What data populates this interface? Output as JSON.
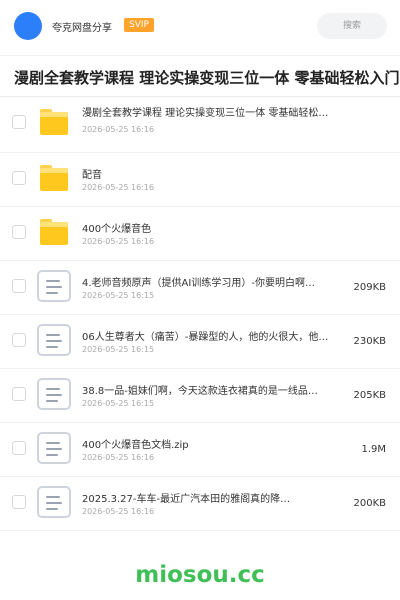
{
  "header": {
    "user_name": "夸克网盘分享",
    "badge": "SVIP",
    "search_placeholder": "搜索",
    "avatar_color": "#2d7ff9"
  },
  "title": "漫剧全套教学课程 理论实操变现三位一体 零基础轻松入门 ·",
  "files": [
    {
      "type": "folder",
      "name": "漫剧全套教学课程 理论实操变现三位一体 零基础轻松…",
      "date": "2026-05-25 16:16",
      "size": ""
    },
    {
      "type": "folder",
      "name": "配音",
      "date": "2026-05-25 16:16",
      "size": ""
    },
    {
      "type": "folder",
      "name": "400个火爆音色",
      "date": "2026-05-25 16:16",
      "size": ""
    },
    {
      "type": "doc",
      "name": "4.老师音频原声（提供AI训练学习用）-你要明白啊…",
      "date": "2026-05-25 16:15",
      "size": "209KB"
    },
    {
      "type": "doc",
      "name": "06人生尊者大（痛苦）-暴躁型的人，他的火很大，他…",
      "date": "2026-05-25 16:15",
      "size": "230KB"
    },
    {
      "type": "doc",
      "name": "38.8一品-姐妹们啊，今天这款连衣裙真的是一线品…",
      "date": "2026-05-25 16:15",
      "size": "205KB"
    },
    {
      "type": "doc",
      "name": "400个火爆音色文档.zip",
      "date": "2026-05-25 16:16",
      "size": "1.9M"
    },
    {
      "type": "doc",
      "name": "2025.3.27-车车-最近广汽本田的雅阁真的降…",
      "date": "2026-05-25 16:16",
      "size": "200KB"
    }
  ],
  "watermark": "miosou.cc",
  "colors": {
    "svip": "#ffa32b",
    "folder": "#ffc81f",
    "watermark": "#3fbf56"
  }
}
